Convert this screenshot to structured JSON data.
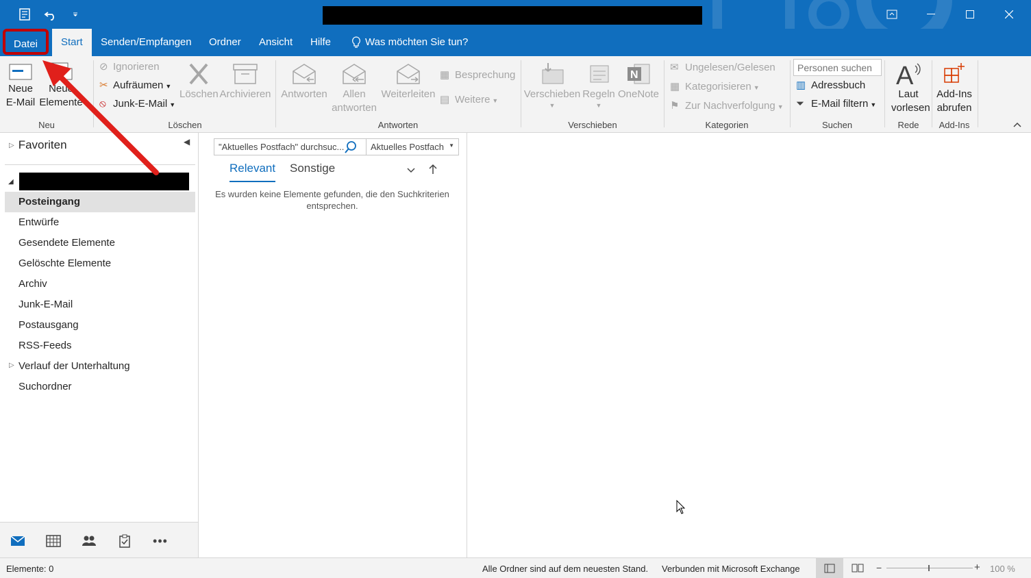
{
  "menu": {
    "tabs": [
      "Datei",
      "Start",
      "Senden/Empfangen",
      "Ordner",
      "Ansicht",
      "Hilfe"
    ],
    "tell_me": "Was möchten Sie tun?"
  },
  "ribbon": {
    "neu": {
      "new_email": "Neue E-Mail",
      "new_items": "Neue Elemente",
      "label": "Neu"
    },
    "loeschen": {
      "ignore": "Ignorieren",
      "cleanup": "Aufräumen",
      "junk": "Junk-E-Mail",
      "delete": "Löschen",
      "archive": "Archivieren",
      "label": "Löschen"
    },
    "antworten": {
      "reply": "Antworten",
      "reply_all": "Allen antworten",
      "forward": "Weiterleiten",
      "meeting": "Besprechung",
      "more": "Weitere",
      "label": "Antworten"
    },
    "verschieben": {
      "move": "Verschieben",
      "rules": "Regeln",
      "onenote": "OneNote",
      "label": "Verschieben"
    },
    "kategorien": {
      "unread_read": "Ungelesen/Gelesen",
      "categorize": "Kategorisieren",
      "follow_up": "Zur Nachverfolgung",
      "label": "Kategorien"
    },
    "suchen": {
      "people_placeholder": "Personen suchen",
      "address_book": "Adressbuch",
      "filter_email": "E-Mail filtern",
      "label": "Suchen"
    },
    "rede": {
      "read_aloud": "Laut vorlesen",
      "label": "Rede"
    },
    "addins": {
      "get_addins": "Add-Ins abrufen",
      "label": "Add-Ins"
    }
  },
  "nav": {
    "favorites": "Favoriten",
    "folders": [
      "Posteingang",
      "Entwürfe",
      "Gesendete Elemente",
      "Gelöschte Elemente",
      "Archiv",
      "Junk-E-Mail",
      "Postausgang",
      "RSS-Feeds",
      "Verlauf der Unterhaltung",
      "Suchordner"
    ],
    "selected": "Posteingang"
  },
  "list": {
    "search_placeholder": "\"Aktuelles Postfach\" durchsuc...",
    "scope": "Aktuelles Postfach",
    "tab_relevant": "Relevant",
    "tab_other": "Sonstige",
    "empty": "Es wurden keine Elemente gefunden, die den Suchkriterien entsprechen."
  },
  "status": {
    "items": "Elemente: 0",
    "sync": "Alle Ordner sind auf dem neuesten Stand.",
    "connection": "Verbunden mit Microsoft Exchange",
    "zoom": "100 %"
  },
  "colors": {
    "accent": "#106ebe",
    "annotation": "#e0201b"
  }
}
